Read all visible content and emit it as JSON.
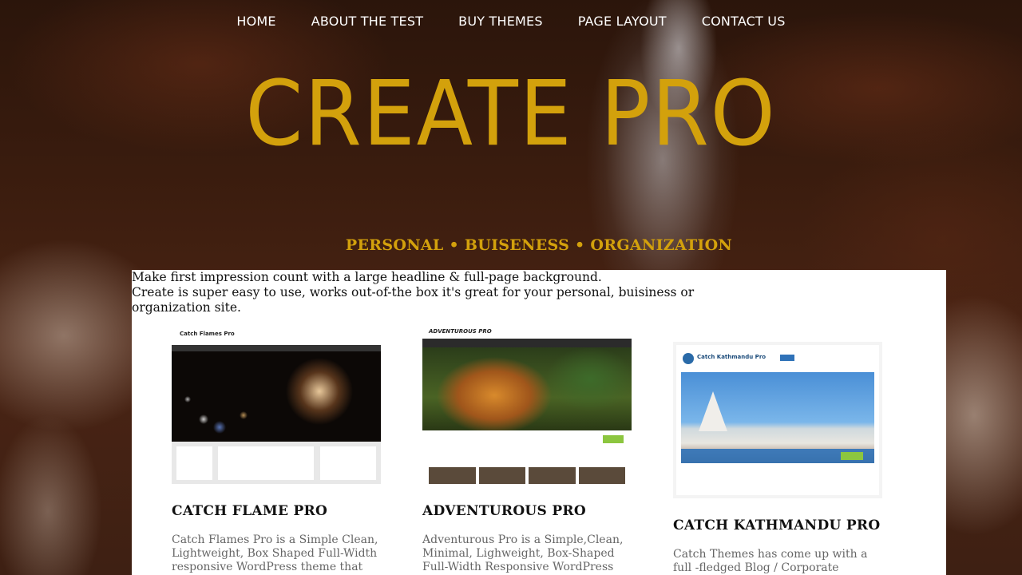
{
  "nav": {
    "items": [
      "HOME",
      "ABOUT THE TEST",
      "BUY THEMES",
      "PAGE LAYOUT",
      "CONTACT US"
    ]
  },
  "hero": {
    "title": "CREATE PRO",
    "tagline": "PERSONAL • BUISENESS • ORGANIZATION"
  },
  "intro": {
    "line1": "Make first impression count with a large headline & full-page background.",
    "line2": "Create is super easy to use, works out-of-the box it's great for your personal, buisiness or organization site."
  },
  "cards": [
    {
      "title": "CATCH FLAME PRO",
      "screenshot_label": "Catch Flames Pro",
      "description": "Catch Flames Pro is a Simple Clean, Lightweight, Box Shaped Full-Width responsive WordPress theme that"
    },
    {
      "title": "ADVENTUROUS PRO",
      "screenshot_label": "ADVENTUROUS PRO",
      "description": "Adventurous Pro is a Simple,Clean, Minimal, Lighweight, Box-Shaped Full-Width Responsive WordPress"
    },
    {
      "title": "CATCH KATHMANDU PRO",
      "screenshot_label": "Catch Kathmandu Pro",
      "description": "Catch Themes has come up with a full -fledged Blog / Corporate WordPress"
    }
  ],
  "colors": {
    "accent": "#d3a10c",
    "panel": "#ffffff"
  }
}
